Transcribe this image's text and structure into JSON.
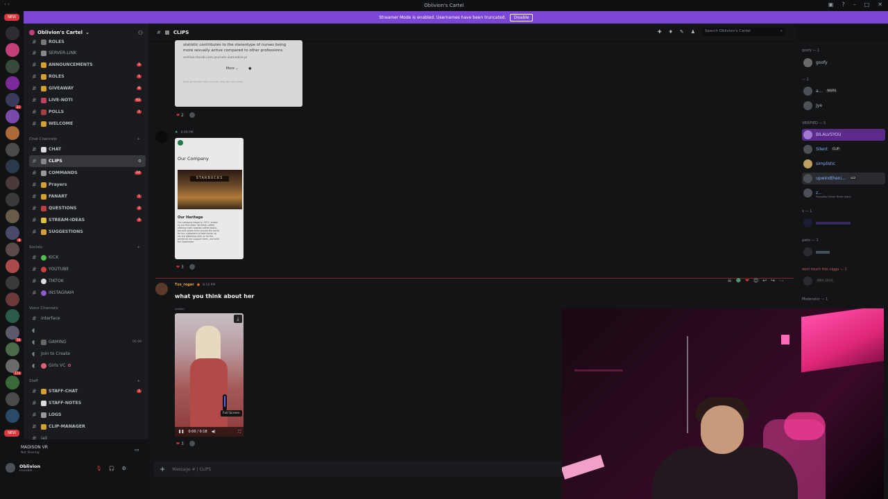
{
  "window": {
    "title": "Oblivion's Cartel"
  },
  "banner": {
    "text": "Streamer Mode is enabled. Usernames have been truncated.",
    "action": "Disable"
  },
  "server_rail": {
    "new_badge": "NEW",
    "bottom_new_badge": "NEW",
    "badges": [
      "21",
      "8",
      "70",
      "174"
    ]
  },
  "server": {
    "name": "Oblivion's Cartel"
  },
  "channels": {
    "top": [
      {
        "name": "ROLES",
        "count": ""
      },
      {
        "name": "SERVER-LINK",
        "count": ""
      },
      {
        "name": "ANNOUNCEMENTS",
        "count": "2"
      },
      {
        "name": "ROLES",
        "count": "1"
      },
      {
        "name": "GIVEAWAY",
        "count": "8"
      },
      {
        "name": "LIVE-NOTI",
        "count": "62"
      },
      {
        "name": "POLLS",
        "count": "1"
      },
      {
        "name": "WELCOME",
        "count": ""
      }
    ],
    "chat_category": "Chat Channels",
    "chat": [
      {
        "name": "CHAT",
        "count": ""
      },
      {
        "name": "CLIPS",
        "count": ""
      },
      {
        "name": "COMMANDS",
        "count": "24"
      },
      {
        "name": "Prayers",
        "count": ""
      },
      {
        "name": "FANART",
        "count": "1"
      },
      {
        "name": "QUESTIONS",
        "count": "2"
      },
      {
        "name": "STREAM-IDEAS",
        "count": "2"
      },
      {
        "name": "SUGGESTIONS",
        "count": ""
      }
    ],
    "socials_category": "Socials",
    "socials": [
      "KICK",
      "YOUTUBE",
      "TIKTOK",
      "INSTAGRAM"
    ],
    "voice_category": "Voice Channels",
    "voice": [
      "interface",
      "GAMING",
      "Join to Create",
      "Girls VC"
    ],
    "voice_gaming_count": "00 99",
    "staff_category": "Staff",
    "staff": [
      {
        "name": "STAFF-CHAT",
        "count": "1"
      },
      {
        "name": "STAFF-NOTES",
        "count": ""
      },
      {
        "name": "LOGS",
        "count": ""
      },
      {
        "name": "CLIP-MANAGER",
        "count": ""
      },
      {
        "name": "jail",
        "count": ""
      }
    ]
  },
  "voice_status": {
    "title": "MADISON VR",
    "sub": "Not Sharing"
  },
  "user": {
    "name": "Oblivion",
    "status": "Invisible"
  },
  "header": {
    "channel": "CLIPS",
    "search_placeholder": "Search Oblivion's Cartel"
  },
  "messages": {
    "embed1": {
      "text": "statistic contributes to the stereotype of nurses being more sexually active compared to other professions.",
      "sources": "archive.thesib.com   journals.viamedica.pl",
      "more": "More",
      "footer": "Auto-generated from sources. May be inaccurate.",
      "reaction_count": "2"
    },
    "msg2": {
      "time": "8:09 PM",
      "reaction_count": "3"
    },
    "card": {
      "title": "Our Company",
      "sign": "STARBUCKS",
      "heading": "Our Heritage",
      "body": "Our company began in 1971, known as our first store. Ida Bean coffee offering fresh-roasted coffee beans, tea and spices from around the world for our customers to take home. as we are attending with us for the period all our support them, and built the Seamaster"
    },
    "msg3": {
      "author": "Txx_roger",
      "time": "8:10 PM",
      "text": "what you think about her",
      "edited": "(edited)",
      "video_time": "0:00 / 0:18",
      "tooltip": "Full Screen",
      "reaction_count": "3"
    }
  },
  "composer": {
    "placeholder": "Message #  | CLIPS"
  },
  "members": {
    "groups": [
      {
        "label": "goofy — 1",
        "members": [
          {
            "name": "goofy",
            "tag": ""
          }
        ]
      },
      {
        "label": "— 2",
        "members": [
          {
            "name": "a...",
            "tag": "NGRS"
          },
          {
            "name": "Jye",
            "tag": ""
          }
        ]
      },
      {
        "label": "VERIFIED — 5",
        "members": [
          {
            "name": "BILALVSYOU",
            "tag": ""
          },
          {
            "name": "Silent",
            "tag": "CLIP"
          },
          {
            "name": "simplistic",
            "tag": ""
          },
          {
            "name": "upwindtheni...",
            "tag": "xzz"
          },
          {
            "name": "z...",
            "tag": "",
            "sub": "YoungBoy Never Broke Again"
          }
        ]
      },
      {
        "label": "x — 1",
        "members": [
          {
            "name": "",
            "tag": ""
          }
        ]
      },
      {
        "label": "patic — 1",
        "members": [
          {
            "name": "",
            "tag": ""
          }
        ]
      },
      {
        "label": "dont touch this nigga — 1",
        "members": [
          {
            "name": "",
            "tag": "NBA 2K26"
          }
        ]
      },
      {
        "label": "Moderator — 1",
        "members": []
      }
    ]
  },
  "colors": {
    "accent": "#7b46d6",
    "danger": "#da373c",
    "author": "#f2a93b"
  }
}
